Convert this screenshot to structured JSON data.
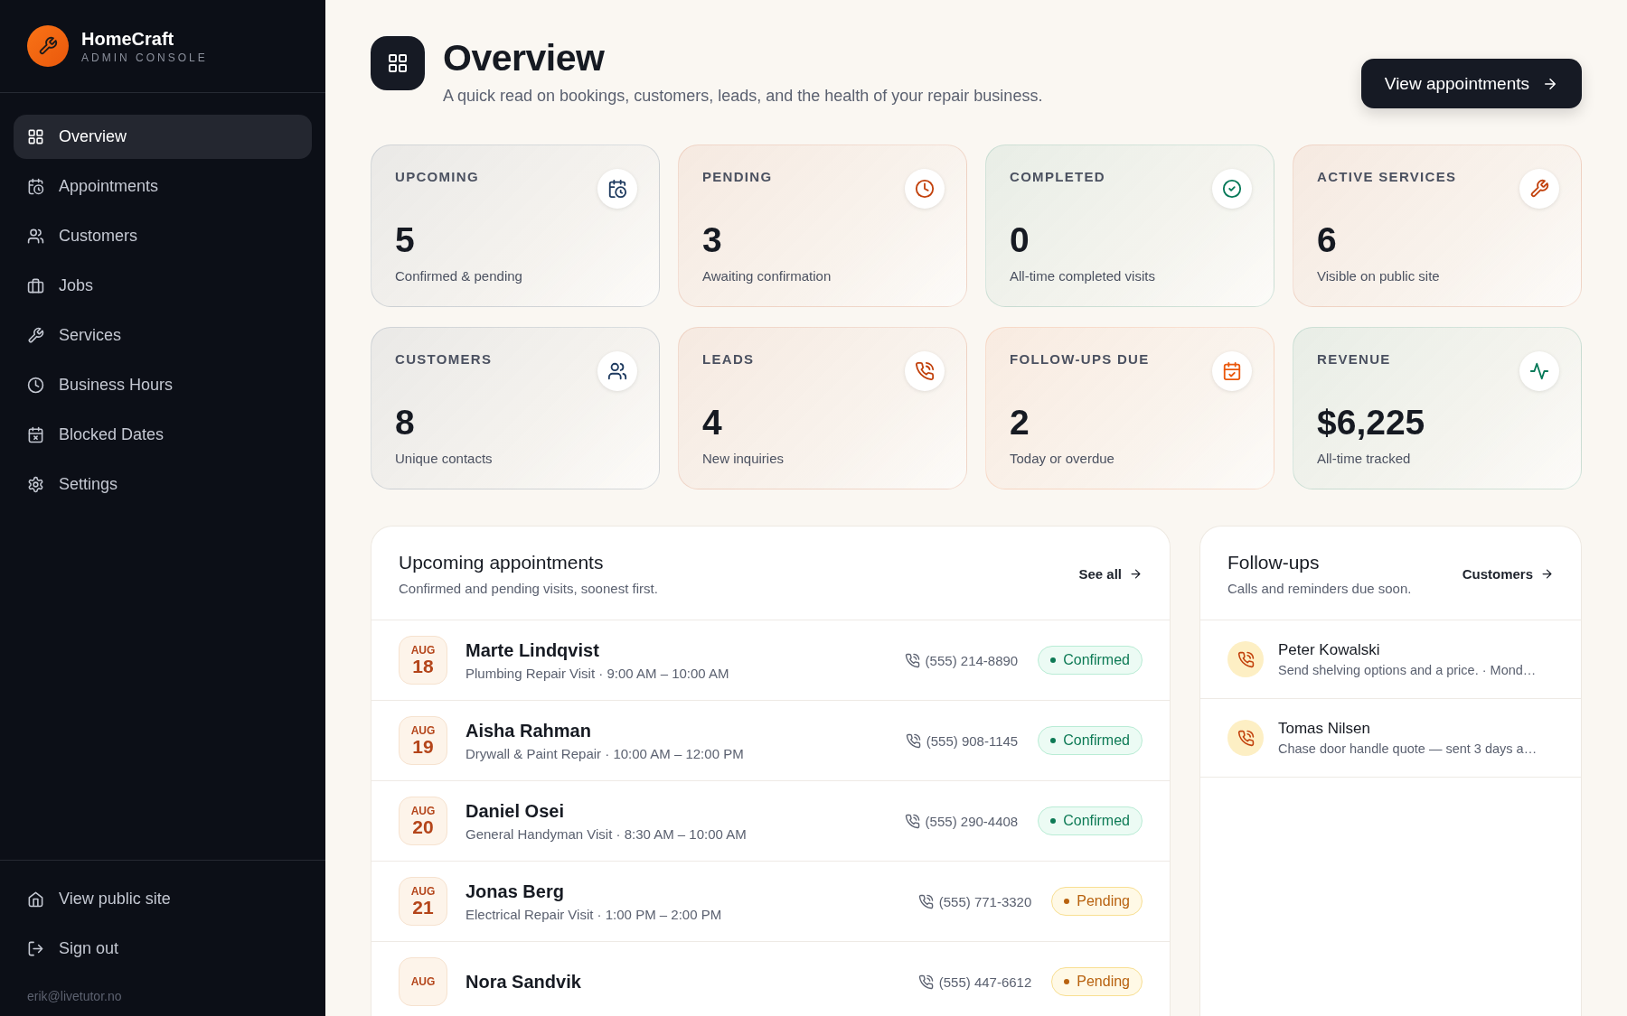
{
  "brand": {
    "name": "HomeCraft",
    "subtitle": "ADMIN CONSOLE"
  },
  "sidebar": {
    "items": [
      {
        "label": "Overview",
        "selected": true
      },
      {
        "label": "Appointments",
        "selected": false
      },
      {
        "label": "Customers",
        "selected": false
      },
      {
        "label": "Jobs",
        "selected": false
      },
      {
        "label": "Services",
        "selected": false
      },
      {
        "label": "Business Hours",
        "selected": false
      },
      {
        "label": "Blocked Dates",
        "selected": false
      },
      {
        "label": "Settings",
        "selected": false
      }
    ],
    "footer_items": [
      {
        "label": "View public site"
      },
      {
        "label": "Sign out"
      }
    ],
    "user_email": "erik@livetutor.no"
  },
  "header": {
    "title": "Overview",
    "subtitle": "A quick read on bookings, customers, leads, and the health of your repair business.",
    "button": "View appointments"
  },
  "stats": [
    {
      "label": "UPCOMING",
      "value": "5",
      "caption": "Confirmed & pending",
      "color": "#1e3a5f"
    },
    {
      "label": "PENDING",
      "value": "3",
      "caption": "Awaiting confirmation",
      "color": "#c2410c"
    },
    {
      "label": "COMPLETED",
      "value": "0",
      "caption": "All-time completed visits",
      "color": "#047857"
    },
    {
      "label": "ACTIVE SERVICES",
      "value": "6",
      "caption": "Visible on public site",
      "color": "#c2410c"
    },
    {
      "label": "CUSTOMERS",
      "value": "8",
      "caption": "Unique contacts",
      "color": "#1e3a5f"
    },
    {
      "label": "LEADS",
      "value": "4",
      "caption": "New inquiries",
      "color": "#c2410c"
    },
    {
      "label": "FOLLOW-UPS DUE",
      "value": "2",
      "caption": "Today or overdue",
      "color": "#ea580c"
    },
    {
      "label": "REVENUE",
      "value": "$6,225",
      "caption": "All-time tracked",
      "color": "#047857"
    }
  ],
  "appointments": {
    "title": "Upcoming appointments",
    "subtitle": "Confirmed and pending visits, soonest first.",
    "link": "See all",
    "rows": [
      {
        "month": "AUG",
        "day": "18",
        "name": "Marte Lindqvist",
        "detail": "Plumbing Repair Visit · 9:00 AM – 10:00 AM",
        "phone": "(555) 214-8890",
        "status": "Confirmed",
        "kind": "confirmed"
      },
      {
        "month": "AUG",
        "day": "19",
        "name": "Aisha Rahman",
        "detail": "Drywall & Paint Repair · 10:00 AM – 12:00 PM",
        "phone": "(555) 908-1145",
        "status": "Confirmed",
        "kind": "confirmed"
      },
      {
        "month": "AUG",
        "day": "20",
        "name": "Daniel Osei",
        "detail": "General Handyman Visit · 8:30 AM – 10:00 AM",
        "phone": "(555) 290-4408",
        "status": "Confirmed",
        "kind": "confirmed"
      },
      {
        "month": "AUG",
        "day": "21",
        "name": "Jonas Berg",
        "detail": "Electrical Repair Visit · 1:00 PM – 2:00 PM",
        "phone": "(555) 771-3320",
        "status": "Pending",
        "kind": "pending"
      },
      {
        "month": "AUG",
        "name": "Nora Sandvik",
        "phone": "(555) 447-6612",
        "status": "Pending",
        "kind": "pending"
      }
    ]
  },
  "followups": {
    "title": "Follow-ups",
    "subtitle": "Calls and reminders due soon.",
    "link": "Customers",
    "items": [
      {
        "name": "Peter Kowalski",
        "note": "Send shelving options and a price. · Mond…"
      },
      {
        "name": "Tomas Nilsen",
        "note": "Chase door handle quote — sent 3 days a…"
      }
    ]
  }
}
